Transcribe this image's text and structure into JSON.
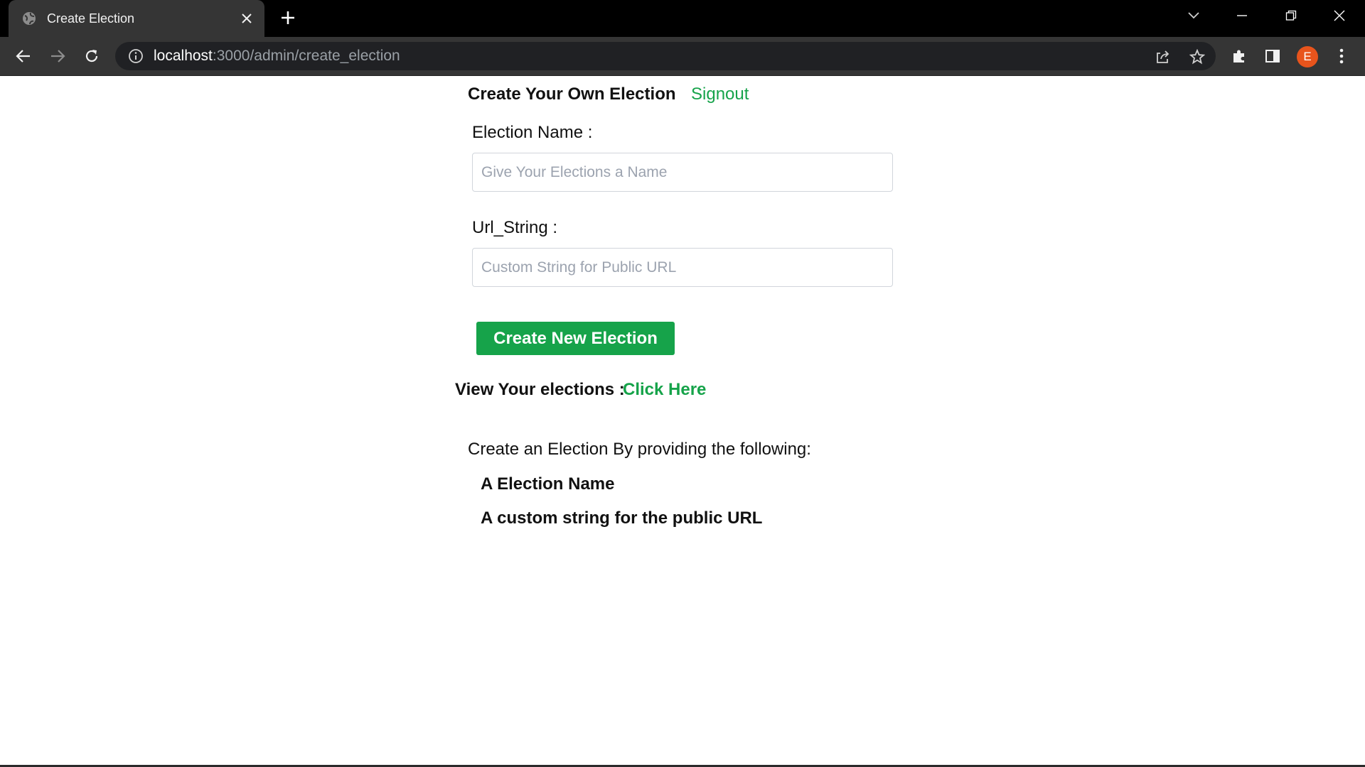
{
  "browser": {
    "tab_title": "Create Election",
    "url_host": "localhost",
    "url_rest": ":3000/admin/create_election",
    "profile_initial": "E"
  },
  "page": {
    "heading": "Create Your Own Election",
    "signout": "Signout",
    "election_name_label": "Election Name :",
    "election_name_placeholder": "Give Your Elections a Name",
    "url_string_label": "Url_String :",
    "url_string_placeholder": "Custom String for Public URL",
    "create_button": "Create New Election",
    "view_label": "View Your elections :",
    "view_link": "Click Here",
    "info_text": "Create an Election By providing the following:",
    "requirements": [
      "A Election Name",
      "A custom string for the public URL"
    ]
  },
  "colors": {
    "accent_green": "#16a34a",
    "profile_orange": "#e8541c"
  }
}
